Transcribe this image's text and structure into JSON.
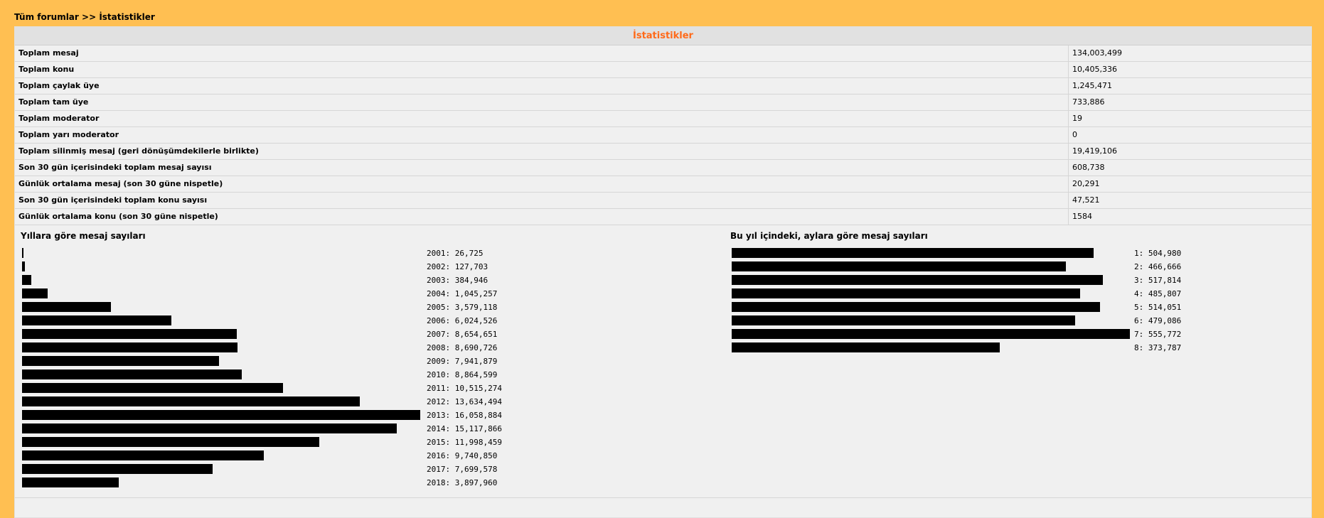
{
  "breadcrumb": {
    "home": "Tüm forumlar",
    "separator": ">>",
    "current": "İstatistikler"
  },
  "panel_title": "İstatistikler",
  "stats": [
    {
      "label": "Toplam mesaj",
      "value": "134,003,499"
    },
    {
      "label": "Toplam konu",
      "value": "10,405,336"
    },
    {
      "label": "Toplam çaylak üye",
      "value": "1,245,471"
    },
    {
      "label": "Toplam tam üye",
      "value": "733,886"
    },
    {
      "label": "Toplam moderator",
      "value": "19"
    },
    {
      "label": "Toplam yarı moderator",
      "value": "0"
    },
    {
      "label": "Toplam silinmiş mesaj (geri dönüşümdekilerle birlikte)",
      "value": "19,419,106"
    },
    {
      "label": "Son 30 gün içerisindeki toplam mesaj sayısı",
      "value": "608,738"
    },
    {
      "label": "Günlük ortalama mesaj (son 30 güne nispetle)",
      "value": "20,291"
    },
    {
      "label": "Son 30 gün içerisindeki toplam konu sayısı",
      "value": "47,521"
    },
    {
      "label": "Günlük ortalama konu (son 30 güne nispetle)",
      "value": "1584"
    }
  ],
  "chart_data": [
    {
      "type": "bar",
      "title": "Yıllara göre mesaj sayıları",
      "orientation": "horizontal",
      "bar_color": "#000000",
      "categories": [
        "2001",
        "2002",
        "2003",
        "2004",
        "2005",
        "2006",
        "2007",
        "2008",
        "2009",
        "2010",
        "2011",
        "2012",
        "2013",
        "2014",
        "2015",
        "2016",
        "2017",
        "2018"
      ],
      "values": [
        26725,
        127703,
        384946,
        1045257,
        3579118,
        6024526,
        8654651,
        8690726,
        7941879,
        8864599,
        10515274,
        13634494,
        16058884,
        15117866,
        11998459,
        9740850,
        7699578,
        3897960
      ],
      "labels": [
        "2001: 26,725",
        "2002: 127,703",
        "2003: 384,946",
        "2004: 1,045,257",
        "2005: 3,579,118",
        "2006: 6,024,526",
        "2007: 8,654,651",
        "2008: 8,690,726",
        "2009: 7,941,879",
        "2010: 8,864,599",
        "2011: 10,515,274",
        "2012: 13,634,494",
        "2013: 16,058,884",
        "2014: 15,117,866",
        "2015: 11,998,459",
        "2016: 9,740,850",
        "2017: 7,699,578",
        "2018: 3,897,960"
      ]
    },
    {
      "type": "bar",
      "title": "Bu yıl içindeki, aylara göre mesaj sayıları",
      "orientation": "horizontal",
      "bar_color": "#000000",
      "categories": [
        "1",
        "2",
        "3",
        "4",
        "5",
        "6",
        "7",
        "8"
      ],
      "values": [
        504980,
        466666,
        517814,
        485807,
        514051,
        479086,
        555772,
        373787
      ],
      "labels": [
        "1: 504,980",
        "2: 466,666",
        "3: 517,814",
        "4: 485,807",
        "5: 514,051",
        "6: 479,086",
        "7: 555,772",
        "8: 373,787"
      ]
    }
  ]
}
